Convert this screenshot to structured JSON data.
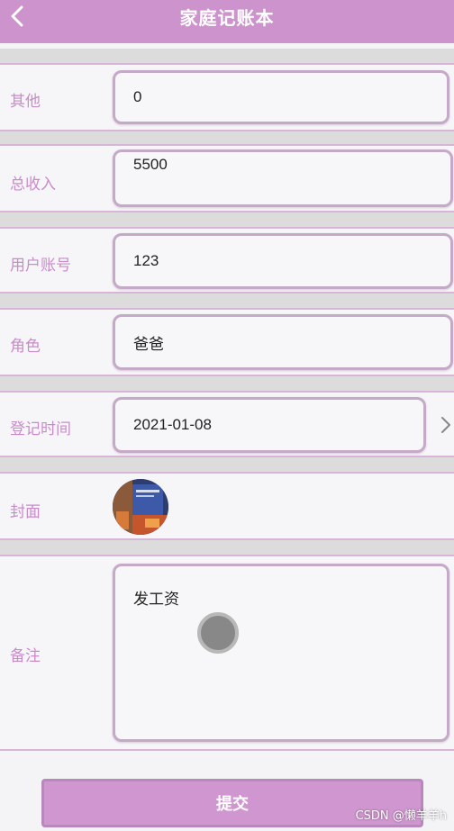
{
  "header": {
    "title": "家庭记账本",
    "back_icon": "chevron-left-icon"
  },
  "fields": {
    "other": {
      "label": "其他",
      "value": "0"
    },
    "total_income": {
      "label": "总收入",
      "value": "5500"
    },
    "user_account": {
      "label": "用户账号",
      "value": "123"
    },
    "role": {
      "label": "角色",
      "value": "爸爸"
    },
    "reg_time": {
      "label": "登记时间",
      "value": "2021-01-08",
      "icon": "chevron-right-icon"
    },
    "cover": {
      "label": "封面",
      "icon": "cover-image"
    },
    "remark": {
      "label": "备注",
      "value": "发工资"
    }
  },
  "submit": {
    "label": "提交"
  },
  "watermark": "CSDN @懒羊羊h",
  "colors": {
    "accent": "#cd93cd",
    "label": "#c98cc9",
    "field_border": "#c5aac8",
    "row_border": "#d7b5d7"
  }
}
